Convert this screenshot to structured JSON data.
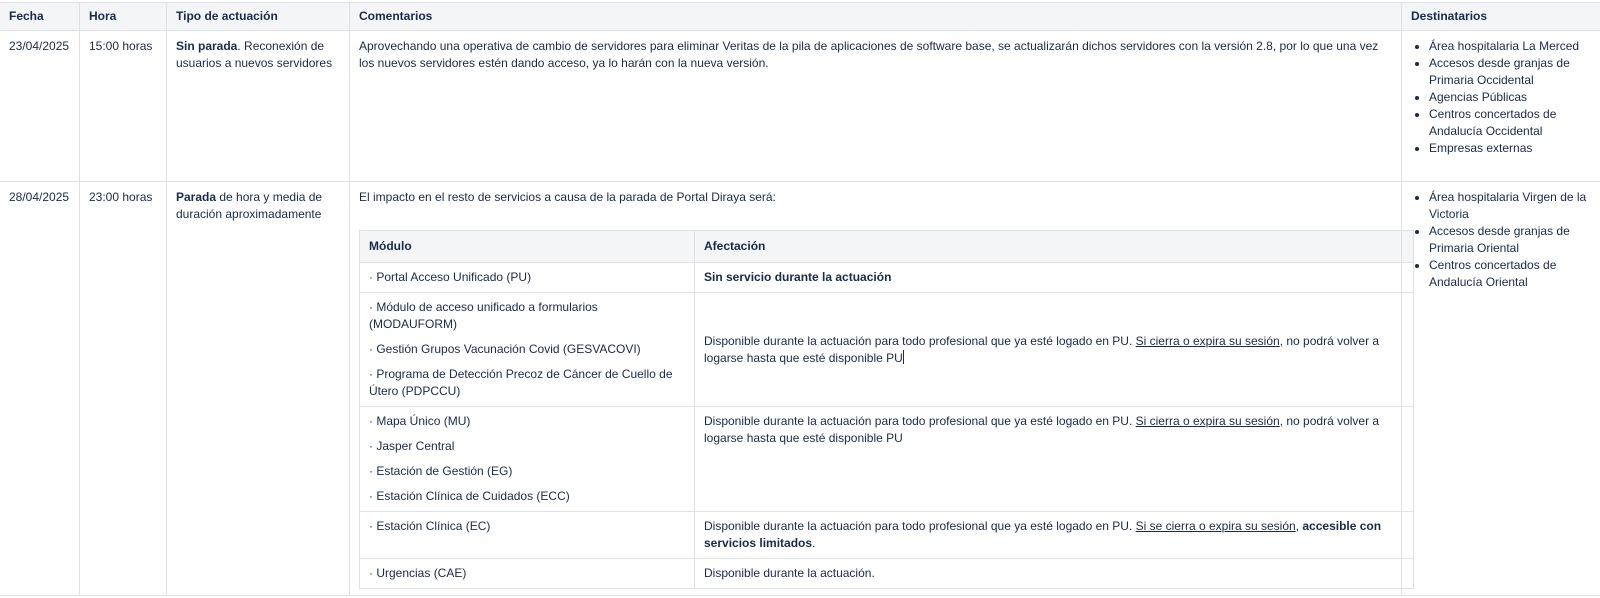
{
  "headers": {
    "fecha": "Fecha",
    "hora": "Hora",
    "tipo": "Tipo de actuación",
    "comentarios": "Comentarios",
    "destinatarios": "Destinatarios"
  },
  "rows": [
    {
      "fecha": "23/04/2025",
      "hora": "15:00 horas",
      "tipo_bold": "Sin parada",
      "tipo_rest": ". Reconexión de usuarios a nuevos servidores",
      "comentario": "Aprovechando una operativa de cambio de servidores para eliminar Veritas de la pila de aplicaciones de software base, se actualizarán dichos servidores con la versión 2.8, por lo que una vez los nuevos servidores estén dando acceso, ya lo harán con la nueva versión.",
      "destinatarios": [
        "Área hospitalaria La Merced",
        "Accesos desde granjas de Primaria Occidental",
        "Agencias Públicas",
        "Centros concertados de Andalucía Occidental",
        "Empresas externas"
      ]
    },
    {
      "fecha": "28/04/2025",
      "hora": "23:00 horas",
      "tipo_bold": "Parada",
      "tipo_rest": " de hora y media de duración aproximadamente",
      "comentario": "El impacto en el resto de servicios a causa de la parada de Portal Diraya será:",
      "destinatarios": [
        "Área hospitalaria Virgen de la Victoria",
        "Accesos desde granjas de Primaria Oriental",
        "Centros concertados de Andalucía Oriental"
      ]
    }
  ],
  "impact_table": {
    "headers": {
      "modulo": "Módulo",
      "afectacion": "Afectación"
    },
    "groups": [
      {
        "modules": [
          "· Portal Acceso Unificado (PU)"
        ],
        "aff_bold": "Sin servicio durante la actuación"
      },
      {
        "modules": [
          "· Módulo de acceso unificado a formularios (MODAUFORM)",
          "· Gestión Grupos Vacunación Covid (GESVACOVI)",
          "·  Programa de Detección Precoz de Cáncer de Cuello de Útero (PDPCCU)"
        ],
        "aff_text": "Disponible durante la actuación para todo profesional que ya esté logado en PU. ",
        "aff_link": "Si cierra o expira su sesión",
        "aff_text2": ", no podrá volver a logarse hasta que esté disponible PU"
      },
      {
        "modules": [
          "· Mapa Único (MU)",
          "· Jasper Central",
          "· Estación de Gestión (EG)",
          "· Estación Clínica de Cuidados (ECC)"
        ],
        "aff_text": "Disponible durante la actuación para todo profesional que ya esté logado en PU. ",
        "aff_link": "Si cierra o expira su sesión",
        "aff_text2": ", no podrá volver a logarse hasta que esté disponible PU"
      },
      {
        "modules": [
          "· Estación Clínica (EC)"
        ],
        "aff_text": "Disponible durante la actuación para todo profesional que ya esté logado en PU. ",
        "aff_link": "Si se cierra o expira su sesión",
        "aff_text2": ", ",
        "aff_bold2": "accesible con servicios limitados",
        "aff_text3": "."
      },
      {
        "modules": [
          "· Urgencias (CAE)"
        ],
        "aff_text": "Disponible durante la actuación."
      }
    ]
  }
}
